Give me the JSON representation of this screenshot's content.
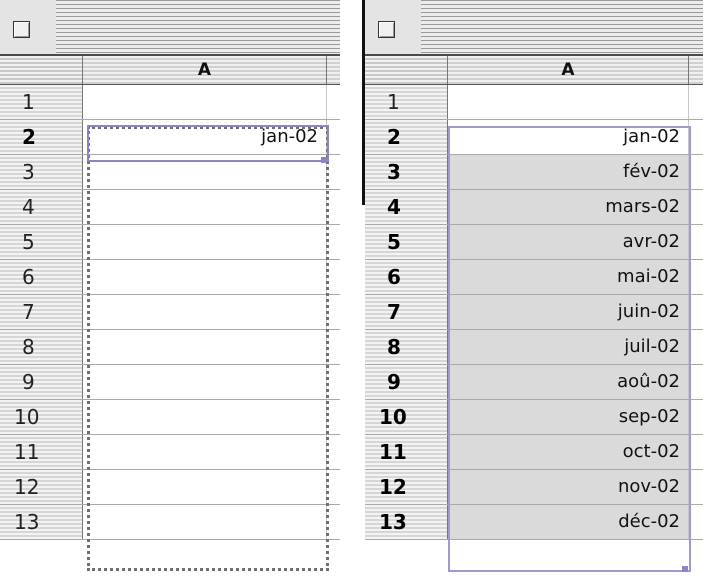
{
  "column_header": "A",
  "left_sheet": {
    "rows": [
      {
        "num": "1",
        "value": "",
        "bold": false
      },
      {
        "num": "2",
        "value": "jan-02",
        "bold": true
      },
      {
        "num": "3",
        "value": "",
        "bold": false
      },
      {
        "num": "4",
        "value": "",
        "bold": false
      },
      {
        "num": "5",
        "value": "",
        "bold": false
      },
      {
        "num": "6",
        "value": "",
        "bold": false
      },
      {
        "num": "7",
        "value": "",
        "bold": false
      },
      {
        "num": "8",
        "value": "",
        "bold": false
      },
      {
        "num": "9",
        "value": "",
        "bold": false
      },
      {
        "num": "10",
        "value": "",
        "bold": false
      },
      {
        "num": "11",
        "value": "",
        "bold": false
      },
      {
        "num": "12",
        "value": "",
        "bold": false
      },
      {
        "num": "13",
        "value": "",
        "bold": false
      }
    ]
  },
  "right_sheet": {
    "rows": [
      {
        "num": "1",
        "value": "",
        "bold": false
      },
      {
        "num": "2",
        "value": "jan-02",
        "bold": true
      },
      {
        "num": "3",
        "value": "fév-02",
        "bold": true
      },
      {
        "num": "4",
        "value": "mars-02",
        "bold": true
      },
      {
        "num": "5",
        "value": "avr-02",
        "bold": true
      },
      {
        "num": "6",
        "value": "mai-02",
        "bold": true
      },
      {
        "num": "7",
        "value": "juin-02",
        "bold": true
      },
      {
        "num": "8",
        "value": "juil-02",
        "bold": true
      },
      {
        "num": "9",
        "value": "aoû-02",
        "bold": true
      },
      {
        "num": "10",
        "value": "sep-02",
        "bold": true
      },
      {
        "num": "11",
        "value": "oct-02",
        "bold": true
      },
      {
        "num": "12",
        "value": "nov-02",
        "bold": true
      },
      {
        "num": "13",
        "value": "déc-02",
        "bold": true
      }
    ]
  },
  "colors": {
    "selection_outline": "#8a86c4",
    "selected_fill": "#dadada",
    "header_stripe": "#d0d0d0"
  }
}
